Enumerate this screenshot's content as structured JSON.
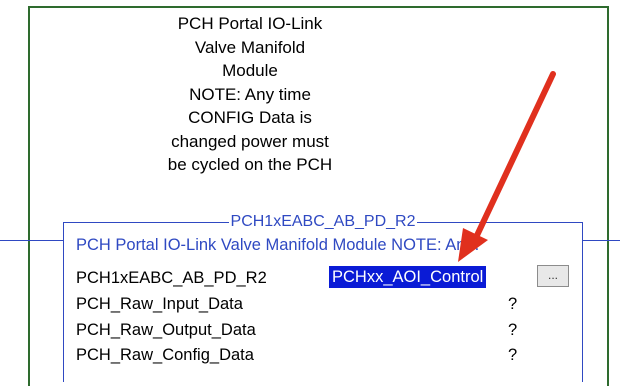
{
  "rung_comment": [
    "PCH Portal IO-Link",
    "Valve Manifold",
    "Module",
    "NOTE: Any time",
    "CONFIG Data is",
    "changed power must",
    "be cycled on the PCH"
  ],
  "block": {
    "title": "PCH1xEABC_AB_PD_R2",
    "description": "PCH Portal IO-Link Valve Manifold Module NOTE: An...",
    "params": [
      {
        "name": "PCH1xEABC_AB_PD_R2",
        "value": "PCHxx_AOI_Control",
        "button": "..."
      },
      {
        "name": "PCH_Raw_Input_Data",
        "value": "?"
      },
      {
        "name": "PCH_Raw_Output_Data",
        "value": "?"
      },
      {
        "name": "PCH_Raw_Config_Data",
        "value": "?"
      }
    ]
  },
  "colors": {
    "rung_border": "#2e6b2e",
    "block_border": "#2f49c2",
    "selection": "#0a1bd6",
    "arrow": "#e0301e"
  },
  "icons": [
    "arrow-annotation-icon"
  ]
}
